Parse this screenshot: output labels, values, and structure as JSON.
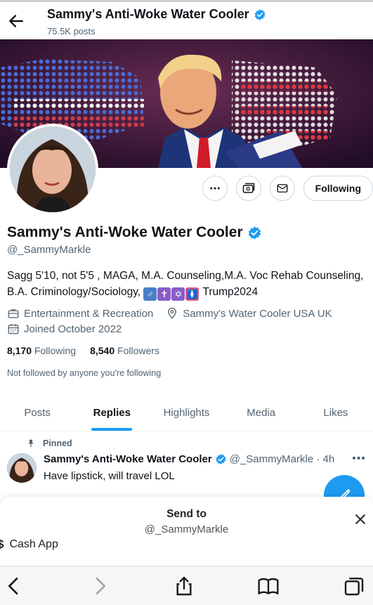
{
  "topbar": {
    "title": "Sammy's Anti-Woke Water Cooler",
    "posts": "75.5K posts"
  },
  "profile": {
    "name": "Sammy's Anti-Woke Water Cooler",
    "handle": "@_SammyMarkle",
    "bio_line1": "Sagg 5'10, not 5'5 , MAGA, M.A. Counseling,M.A. Voc Rehab Counseling,",
    "bio_line2_prefix": "B.A. Criminology/Sociology,",
    "bio_line2_suffix": "Trump2024",
    "category": "Entertainment & Recreation",
    "location": "Sammy's Water Cooler USA UK",
    "joined": "Joined October 2022",
    "following_count": "8,170",
    "following_label": "Following",
    "followers_count": "8,540",
    "followers_label": "Followers",
    "not_followed": "Not followed by anyone you're following",
    "follow_button": "Following"
  },
  "tabs": [
    "Posts",
    "Replies",
    "Highlights",
    "Media",
    "Likes"
  ],
  "active_tab": "Replies",
  "pinned_tweet": {
    "pinned_label": "Pinned",
    "name": "Sammy's Anti-Woke Water Cooler",
    "handle_time": "@_SammyMarkle · 4h",
    "text": "Have lipstick, will travel LOL"
  },
  "share_sheet": {
    "title": "Send to",
    "subtitle": "@_SammyMarkle",
    "app": "Cash App"
  },
  "colors": {
    "accent": "#1d9bf0",
    "text": "#0f1419",
    "muted": "#536471"
  },
  "icons": [
    "back-arrow-icon",
    "verified-badge-icon",
    "more-icon",
    "subscribe-icon",
    "message-icon",
    "briefcase-icon",
    "location-pin-icon",
    "calendar-icon",
    "pin-icon",
    "compose-icon",
    "close-icon",
    "safari-back-icon",
    "safari-forward-icon",
    "share-icon",
    "bookmarks-icon",
    "tabs-icon"
  ]
}
